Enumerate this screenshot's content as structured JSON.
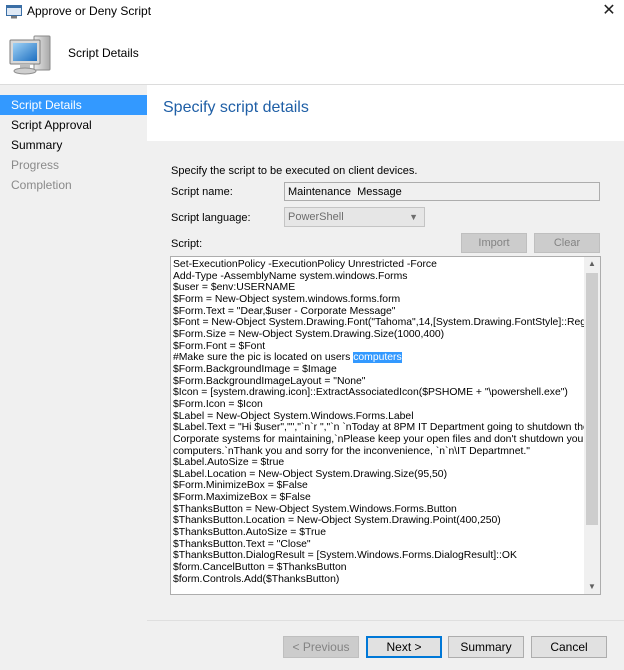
{
  "window": {
    "title": "Approve or Deny Script",
    "close_glyph": "✕",
    "icon": "script-window-icon"
  },
  "header": {
    "title": "Script Details",
    "icon": "computer-monitor-icon"
  },
  "sidebar": {
    "items": [
      {
        "label": "Script Details",
        "state": "active"
      },
      {
        "label": "Script Approval",
        "state": "normal"
      },
      {
        "label": "Summary",
        "state": "normal"
      },
      {
        "label": "Progress",
        "state": "disabled"
      },
      {
        "label": "Completion",
        "state": "disabled"
      }
    ]
  },
  "main": {
    "page_title": "Specify script details",
    "description": "Specify the script to be executed on client devices.",
    "script_name": {
      "label": "Script name:",
      "value": "Maintenance  Message"
    },
    "script_language": {
      "label": "Script language:",
      "value": "PowerShell"
    },
    "script": {
      "label": "Script:",
      "import_label": "Import",
      "clear_label": "Clear",
      "lines": [
        "Set-ExecutionPolicy -ExecutionPolicy Unrestricted -Force",
        "Add-Type -AssemblyName system.windows.Forms",
        "$user = $env:USERNAME",
        "$Form = New-Object system.windows.forms.form",
        "$Form.Text = \"Dear,$user - Corporate Message\"",
        "$Font = New-Object System.Drawing.Font(\"Tahoma\",14,[System.Drawing.FontStyle]::Regular)",
        "$Form.Size = New-Object System.Drawing.Size(1000,400)",
        "$Form.Font = $Font",
        "#Make sure the pic is located on users ",
        "$Form.BackgroundImage = $Image",
        "$Form.BackgroundImageLayout = \"None\"",
        "$Icon = [system.drawing.icon]::ExtractAssociatedIcon($PSHOME + \"\\powershell.exe\")",
        "$Form.Icon = $Icon",
        "$Label = New-Object System.Windows.Forms.Label",
        "$Label.Text = \"Hi $user\",\"\",\"`n`r \",\"`n `nToday at 8PM IT Department going to shutdown the",
        "Corporate systems for maintaining,`nPlease keep your open files and don't shutdown your",
        "computers.`nThank you and sorry for the inconvenience, `n`n\\IT Departmnet.\"",
        "$Label.AutoSize = $true",
        "$Label.Location = New-Object System.Drawing.Size(95,50)",
        "$Form.MinimizeBox = $False",
        "$Form.MaximizeBox = $False",
        "$ThanksButton = New-Object System.Windows.Forms.Button",
        "$ThanksButton.Location = New-Object System.Drawing.Point(400,250)",
        "$ThanksButton.AutoSize = $True",
        "$ThanksButton.Text = \"Close\"",
        "$ThanksButton.DialogResult = [System.Windows.Forms.DialogResult]::OK",
        "$form.CancelButton = $ThanksButton",
        "$form.Controls.Add($ThanksButton)"
      ],
      "highlighted_word": "computers",
      "highlighted_line_index": 8
    }
  },
  "footer": {
    "previous_label": "< Previous",
    "next_label": "Next >",
    "summary_label": "Summary",
    "cancel_label": "Cancel"
  },
  "colors": {
    "accent": "#3399ff",
    "title_blue": "#1f5fa6",
    "panel_bg": "#f0f0f0"
  }
}
